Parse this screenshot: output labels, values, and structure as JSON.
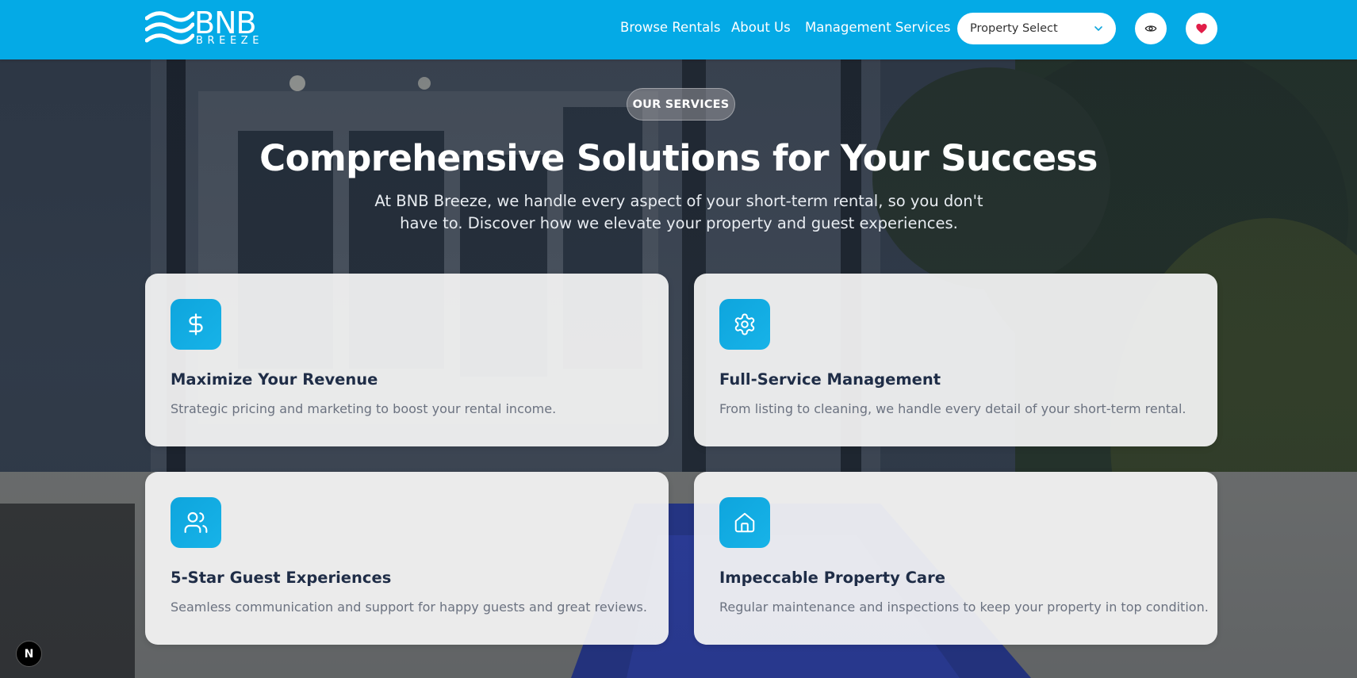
{
  "brand": {
    "name": "BNB",
    "subname": "BREEZE"
  },
  "nav": {
    "links": [
      "Browse Rentals",
      "About Us",
      "Management Services"
    ],
    "property_select": {
      "value": "Property Select"
    },
    "icons": [
      "eye-icon",
      "heart-icon"
    ]
  },
  "section": {
    "badge": "OUR SERVICES",
    "title": "Comprehensive Solutions for Your Success",
    "description": "At BNB Breeze, we handle every aspect of your short-term rental, so you don't have to. Discover how we elevate your property and guest experiences."
  },
  "cards": [
    {
      "icon": "dollar-icon",
      "title": "Maximize Your Revenue",
      "description": "Strategic pricing and marketing to boost your rental income."
    },
    {
      "icon": "gear-icon",
      "title": "Full-Service Management",
      "description": "From listing to cleaning, we handle every detail of your short-term rental."
    },
    {
      "icon": "users-icon",
      "title": "5-Star Guest Experiences",
      "description": "Seamless communication and support for happy guests and great reviews."
    },
    {
      "icon": "house-icon",
      "title": "Impeccable Property Care",
      "description": "Regular maintenance and inspections to keep your property in top condition."
    }
  ],
  "dev_badge": "N",
  "colors": {
    "header": "#04aae6",
    "icon_bg": "#0ea5dd",
    "card_title": "#1f2d47",
    "card_text": "#6b7280",
    "heart": "#e11d48"
  }
}
